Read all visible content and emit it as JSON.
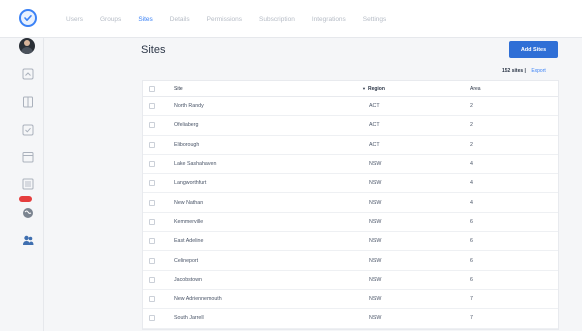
{
  "nav": {
    "items": [
      "Users",
      "Groups",
      "Sites",
      "Details",
      "Permissions",
      "Subscription",
      "Integrations",
      "Settings"
    ],
    "active": "Sites"
  },
  "page": {
    "title": "Sites",
    "add_button": "Add Sites",
    "count_text": "152 sites |",
    "export_label": "Export"
  },
  "table": {
    "headers": {
      "site": "Site",
      "region": "Region",
      "area": "Area"
    },
    "sort_indicator": "▼",
    "rows": [
      {
        "site": "North Randy",
        "region": "ACT",
        "area": "2"
      },
      {
        "site": "Ofeliaberg",
        "region": "ACT",
        "area": "2"
      },
      {
        "site": "Eliborough",
        "region": "ACT",
        "area": "2"
      },
      {
        "site": "Lake Sashahaven",
        "region": "NSW",
        "area": "4"
      },
      {
        "site": "Langworthfurt",
        "region": "NSW",
        "area": "4"
      },
      {
        "site": "New Nathan",
        "region": "NSW",
        "area": "4"
      },
      {
        "site": "Kemmerville",
        "region": "NSW",
        "area": "6"
      },
      {
        "site": "East Adeline",
        "region": "NSW",
        "area": "6"
      },
      {
        "site": "Celineport",
        "region": "NSW",
        "area": "6"
      },
      {
        "site": "Jacobstown",
        "region": "NSW",
        "area": "6"
      },
      {
        "site": "New Adriennemouth",
        "region": "NSW",
        "area": "7"
      },
      {
        "site": "South Jarrell",
        "region": "NSW",
        "area": "7"
      }
    ]
  },
  "sidebar": {
    "icons": [
      "avatar",
      "home-icon",
      "document-icon",
      "checklist-icon",
      "calendar-icon",
      "chart-icon",
      "globe-icon",
      "users-icon"
    ]
  },
  "colors": {
    "accent": "#2f6fd6",
    "badge": "#e53e3e"
  }
}
